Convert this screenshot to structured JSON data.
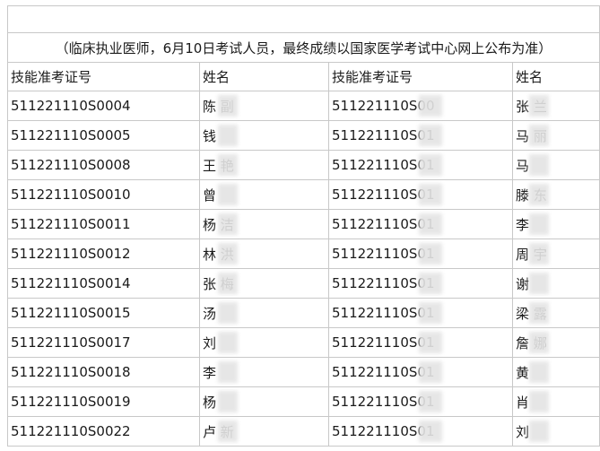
{
  "note": "（临床执业医师，6月10日考试人员，最终成绩以国家医学考试中心网上公布为准）",
  "headers": [
    "技能准考证号",
    "姓名",
    "技能准考证号",
    "姓名"
  ],
  "rows": [
    {
      "id1": "511221110S0004",
      "name1": "陈  副",
      "id2": "511221110S00",
      "name2": "张  兰"
    },
    {
      "id1": "511221110S0005",
      "name1": "钱",
      "id2": "511221110S01",
      "name2": "马  丽"
    },
    {
      "id1": "511221110S0008",
      "name1": "王  艳",
      "id2": "511221110S01",
      "name2": "马"
    },
    {
      "id1": "511221110S0010",
      "name1": "曾",
      "id2": "511221110S01",
      "name2": "滕  东"
    },
    {
      "id1": "511221110S0011",
      "name1": "杨  洁",
      "id2": "511221110S01",
      "name2": "李"
    },
    {
      "id1": "511221110S0012",
      "name1": "林  洪",
      "id2": "511221110S01",
      "name2": "周  宇"
    },
    {
      "id1": "511221110S0014",
      "name1": "张  梅",
      "id2": "511221110S01",
      "name2": "谢"
    },
    {
      "id1": "511221110S0015",
      "name1": "汤",
      "id2": "511221110S01",
      "name2": "梁  露"
    },
    {
      "id1": "511221110S0017",
      "name1": "刘",
      "id2": "511221110S01",
      "name2": "詹  娜"
    },
    {
      "id1": "511221110S0018",
      "name1": "李",
      "id2": "511221110S01",
      "name2": "黄"
    },
    {
      "id1": "511221110S0019",
      "name1": "杨",
      "id2": "511221110S01",
      "name2": "肖"
    },
    {
      "id1": "511221110S0022",
      "name1": "卢  新",
      "id2": "511221110S01",
      "name2": "刘"
    }
  ]
}
